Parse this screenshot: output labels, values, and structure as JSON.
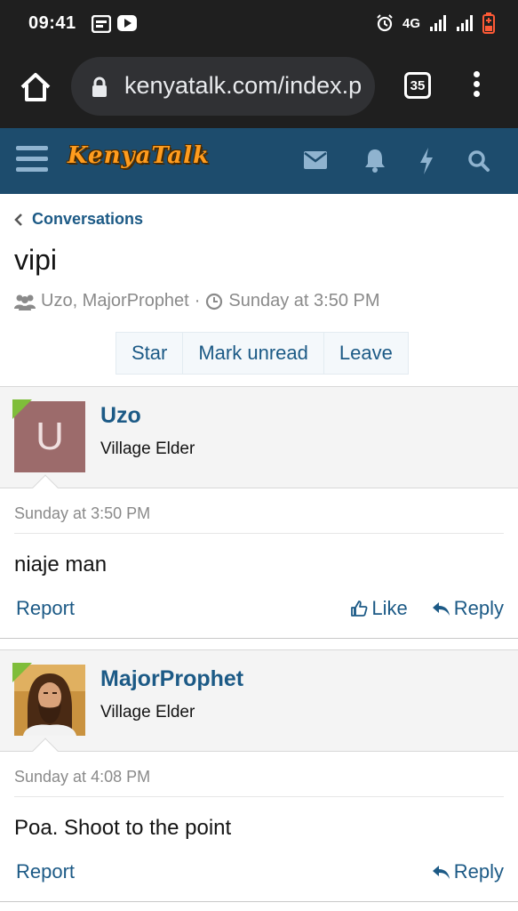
{
  "status_bar": {
    "time": "09:41",
    "network": "4G"
  },
  "browser": {
    "url": "kenyatalk.com/index.p",
    "tab_count": "35"
  },
  "site": {
    "logo": "KenyaTalk"
  },
  "breadcrumb": {
    "label": "Conversations"
  },
  "conversation": {
    "title": "vipi",
    "participants": "Uzo, MajorProphet",
    "separator": "·",
    "date": "Sunday at 3:50 PM"
  },
  "actions": {
    "star": "Star",
    "mark_unread": "Mark unread",
    "leave": "Leave"
  },
  "messages": [
    {
      "author": "Uzo",
      "avatar_letter": "U",
      "user_title": "Village Elder",
      "date": "Sunday at 3:50 PM",
      "text": "niaje man",
      "report": "Report",
      "like": "Like",
      "reply": "Reply"
    },
    {
      "author": "MajorProphet",
      "user_title": "Village Elder",
      "date": "Sunday at 4:08 PM",
      "text": "Poa. Shoot to the point",
      "report": "Report",
      "reply": "Reply"
    }
  ],
  "colors": {
    "header_bg": "#1d4c6d",
    "link": "#1c5a86",
    "logo": "#ff9c1e",
    "online": "#7fbd3a",
    "avatar_letter_bg": "#9c6b6b"
  }
}
